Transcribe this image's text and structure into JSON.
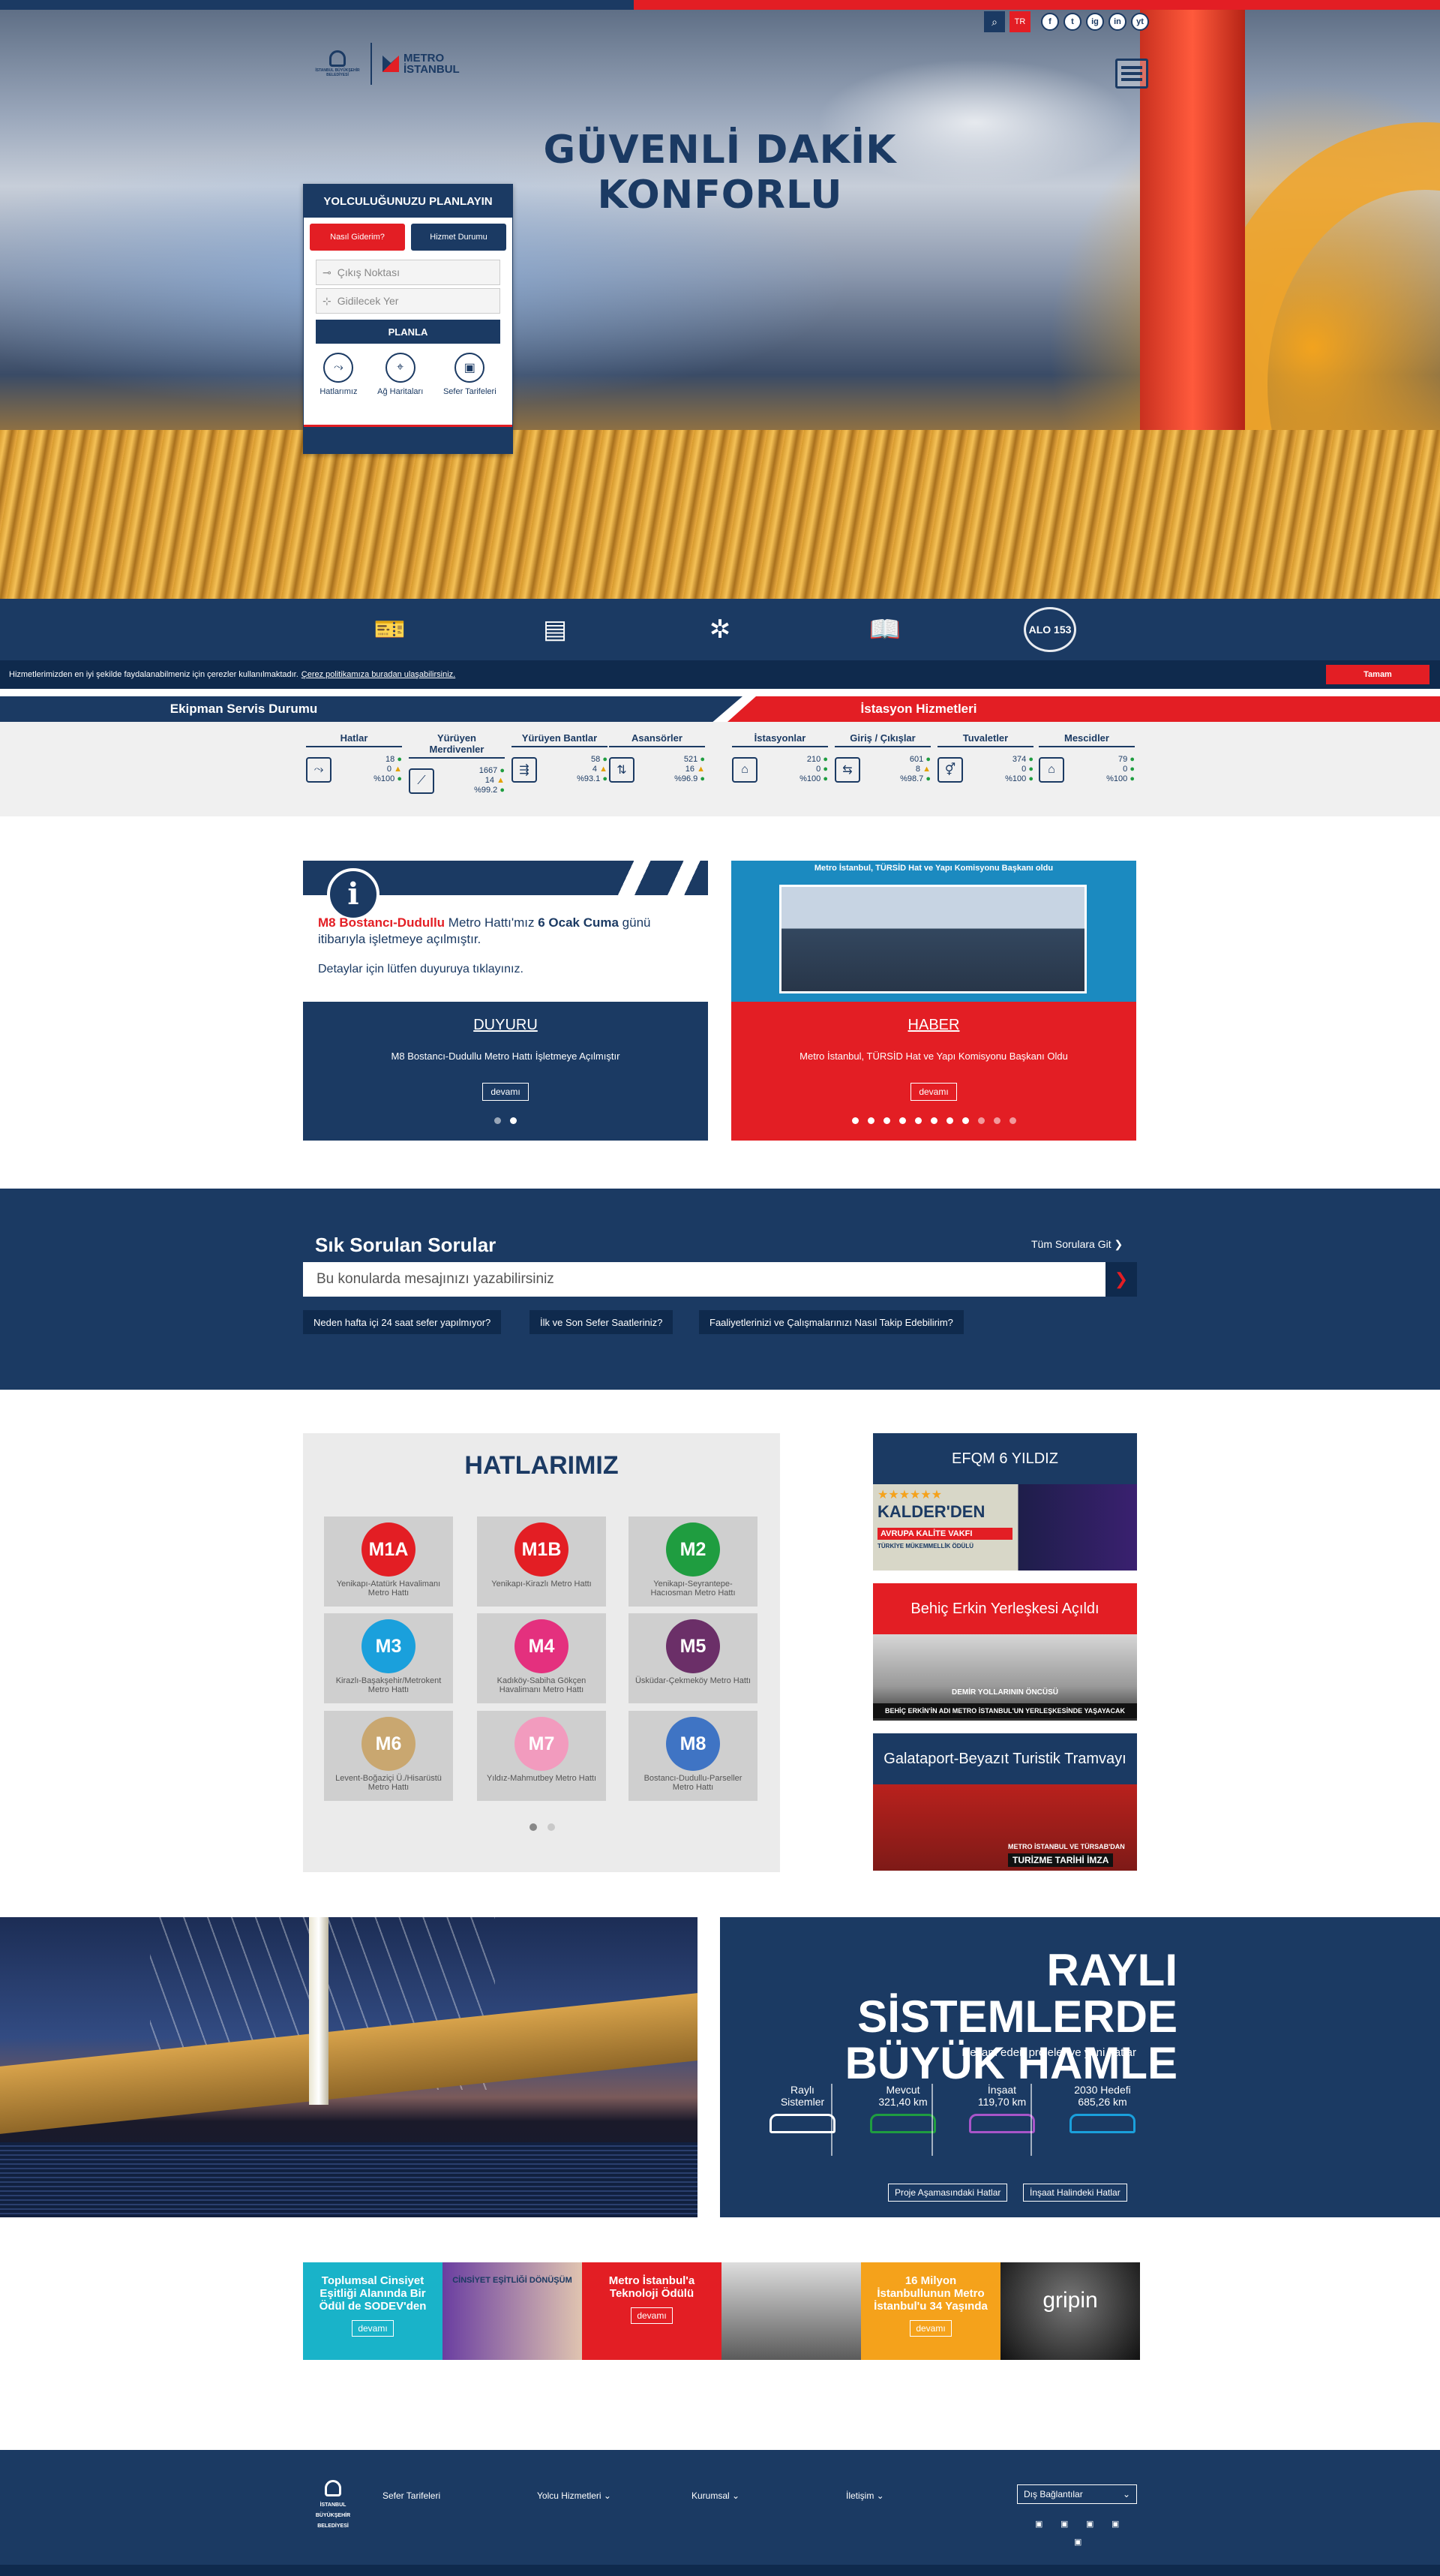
{
  "header": {
    "ibb_logo_text": "İSTANBUL BÜYÜKŞEHİR BELEDİYESİ",
    "metro_logo_line1": "METRO",
    "metro_logo_line2": "İSTANBUL",
    "search_icon": "search-icon",
    "language": "TR",
    "social": [
      "f",
      "t",
      "ig",
      "in",
      "yt"
    ]
  },
  "hero": {
    "title": "GÜVENLİ DAKİK KONFORLU"
  },
  "planner": {
    "title": "YOLCULUĞUNUZU PLANLAYIN",
    "tab_how": "Nasıl Giderim?",
    "tab_service": "Hizmet Durumu",
    "from_placeholder": "Çıkış Noktası",
    "to_placeholder": "Gidilecek Yer",
    "plan_button": "PLANLA",
    "links": [
      "Hatlarımız",
      "Ağ Haritaları",
      "Sefer Tarifeleri"
    ]
  },
  "iconbar": {
    "items": [
      "ticket-icon",
      "ticket-machine-icon",
      "station-icon",
      "guide-icon"
    ],
    "alo": "ALO 153"
  },
  "cookie": {
    "text": "Hizmetlerimizden en iyi şekilde faydalanabilmeniz için çerezler kullanılmaktadır.",
    "link": "Çerez politikamıza buradan ulaşabilirsiniz.",
    "ok": "Tamam"
  },
  "status": {
    "left_title": "Ekipman Servis Durumu",
    "right_title": "İstasyon Hizmetleri",
    "columns": [
      {
        "h": "Hatlar",
        "v1": "18",
        "v2": "0",
        "v3": "%100"
      },
      {
        "h": "Yürüyen Merdivenler",
        "v1": "1667",
        "v2": "14",
        "v3": "%99.2"
      },
      {
        "h": "Yürüyen Bantlar",
        "v1": "58",
        "v2": "4",
        "v3": "%93.1"
      },
      {
        "h": "Asansörler",
        "v1": "521",
        "v2": "16",
        "v3": "%96.9"
      },
      {
        "h": "İstasyonlar",
        "v1": "210",
        "v2": "0",
        "v3": "%100"
      },
      {
        "h": "Giriş / Çıkışlar",
        "v1": "601",
        "v2": "8",
        "v3": "%98.7"
      },
      {
        "h": "Tuvaletler",
        "v1": "374",
        "v2": "0",
        "v3": "%100"
      },
      {
        "h": "Mescidler",
        "v1": "79",
        "v2": "0",
        "v3": "%100"
      }
    ]
  },
  "news": {
    "announcement": {
      "red": "M8 Bostancı-Dudullu",
      "text1": " Metro Hattı'mız ",
      "bold": "6 Ocak Cuma",
      "text2": " günü itibarıyla işletmeye açılmıştır.",
      "detail": "Detaylar için lütfen duyuruya tıklayınız.",
      "label": "DUYURU",
      "summary": "M8 Bostancı-Dudullu Metro Hattı İşletmeye Açılmıştır",
      "more": "devamı"
    },
    "news_item": {
      "banner": "Metro İstanbul, TÜRSİD Hat ve Yapı Komisyonu Başkanı oldu",
      "label": "HABER",
      "summary": "Metro İstanbul, TÜRSİD Hat ve Yapı Komisyonu Başkanı Oldu",
      "more": "devamı"
    }
  },
  "faq": {
    "title": "Sık Sorulan Sorular",
    "all": "Tüm Sorulara Git ❯",
    "placeholder": "Bu konularda mesajınızı yazabilirsiniz",
    "chips": [
      "Neden hafta içi 24 saat sefer yapılmıyor?",
      "İlk ve Son Sefer Saatleriniz?",
      "Faaliyetlerinizi ve Çalışmalarınızı Nasıl Takip Edebilirim?"
    ]
  },
  "lines": {
    "title": "HATLARIMIZ",
    "items": [
      {
        "code": "M1A",
        "desc": "Yenikapı-Atatürk Havalimanı Metro Hattı",
        "color": "#e31e24"
      },
      {
        "code": "M1B",
        "desc": "Yenikapı-Kirazlı Metro Hattı",
        "color": "#e31e24"
      },
      {
        "code": "M2",
        "desc": "Yenikapı-Seyrantepe-Hacıosman Metro Hattı",
        "color": "#1f9d40"
      },
      {
        "code": "M3",
        "desc": "Kirazlı-Başakşehir/Metrokent Metro Hattı",
        "color": "#1aa0dc"
      },
      {
        "code": "M4",
        "desc": "Kadıköy-Sabiha Gökçen Havalimanı Metro Hattı",
        "color": "#e4307e"
      },
      {
        "code": "M5",
        "desc": "Üsküdar-Çekmeköy Metro Hattı",
        "color": "#6b2f68"
      },
      {
        "code": "M6",
        "desc": "Levent-Boğaziçi Ü./Hisarüstü Metro Hattı",
        "color": "#c9a770"
      },
      {
        "code": "M7",
        "desc": "Yıldız-Mahmutbey Metro Hattı",
        "color": "#f29bbe"
      },
      {
        "code": "M8",
        "desc": "Bostancı-Dudullu-Parseller Metro Hattı",
        "color": "#3f74c4"
      }
    ]
  },
  "side_news": [
    {
      "title": "EFQM 6 YILDIZ",
      "bg": "#1b3a63",
      "img_text1": "KALDER'DEN",
      "img_text2": "AVRUPA KALİTE VAKFI",
      "img_text3": "TÜRKİYE MÜKEMMELLİK ÖDÜLÜ"
    },
    {
      "title": "Behiç Erkin Yerleşkesi Açıldı",
      "bg": "#e31e24",
      "img_text1": "DEMİR YOLLARININ ÖNCÜSÜ",
      "img_text2": "BEHİÇ ERKİN'İN ADI METRO İSTANBUL'UN YERLEŞKESİNDE YAŞAYACAK",
      "img_text3": ""
    },
    {
      "title": "Galataport-Beyazıt Turistik Tramvayı",
      "bg": "#1b3a63",
      "img_text1": "METRO İSTANBUL VE TÜRSAB'DAN",
      "img_text2": "TURİZME TARİHİ İMZA",
      "img_text3": ""
    }
  ],
  "rail": {
    "title1": "RAYLI SİSTEMLERDE",
    "title2": "BÜYÜK HAMLE",
    "subtitle": "Devam eden projeler ve yeni hatlar",
    "stats": [
      {
        "l1": "Raylı",
        "l2": "Sistemler",
        "color": "#ffffff"
      },
      {
        "l1": "Mevcut",
        "l2": "321,40 km",
        "color": "#1f9d40"
      },
      {
        "l1": "İnşaat",
        "l2": "119,70 km",
        "color": "#a855c9"
      },
      {
        "l1": "2030 Hedefi",
        "l2": "685,26 km",
        "color": "#1aa0dc"
      }
    ],
    "btn1": "Proje Aşamasındaki Hatlar",
    "btn2": "İnşaat Halindeki Hatlar"
  },
  "promos": [
    {
      "text": "Toplumsal Cinsiyet Eşitliği Alanında Bir Ödül de SODEV'den",
      "more": "devamı",
      "bg": "#19b3c9"
    },
    {
      "text": "CİNSİYET EŞİTLİĞİ DÖNÜŞÜM",
      "more": "",
      "bg": "#6a3ea1"
    },
    {
      "text": "Metro İstanbul'a Teknoloji Ödülü",
      "more": "devamı",
      "bg": "#e31e24"
    },
    {
      "text": "",
      "more": "",
      "bg": "#8b8b8b"
    },
    {
      "text": "16 Milyon İstanbullunun Metro İstanbul'u 34 Yaşında",
      "more": "devamı",
      "bg": "#f5a21b"
    },
    {
      "text": "gripin",
      "more": "",
      "bg": "#222222"
    }
  ],
  "footer": {
    "logo": "İSTANBUL BÜYÜKŞEHİR BELEDİYESİ",
    "links": [
      "Sefer Tarifeleri",
      "Yolcu Hizmetleri ⌄",
      "Kurumsal ⌄",
      "İletişim ⌄"
    ],
    "external": "Dış Bağlantılar"
  }
}
